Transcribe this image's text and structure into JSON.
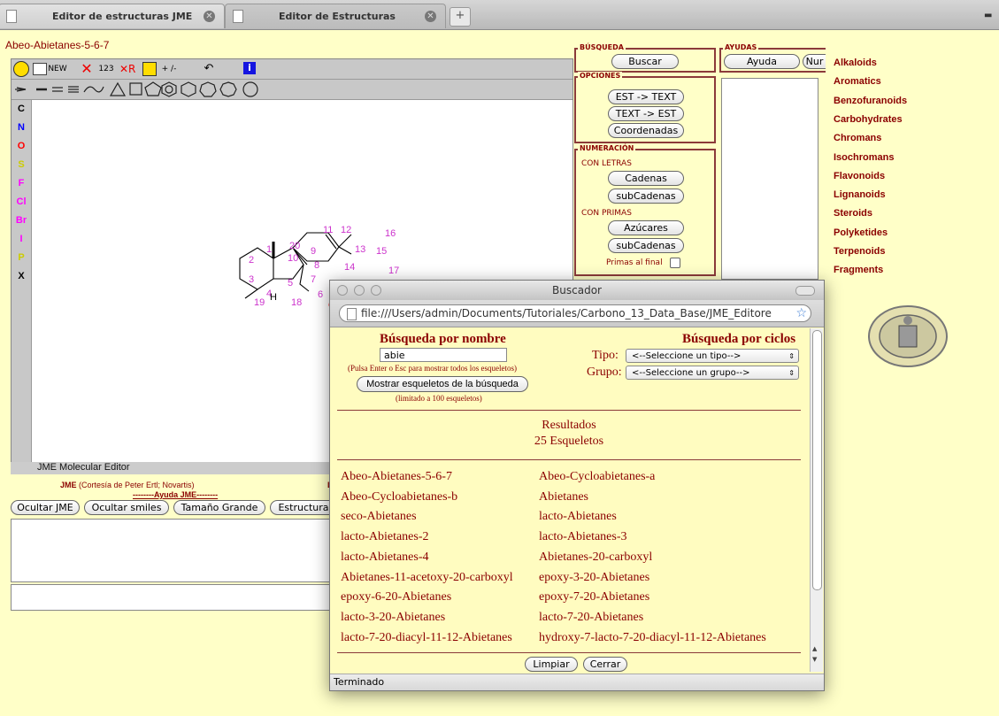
{
  "tabs": [
    {
      "title": "Editor de estructuras JME"
    },
    {
      "title": "Editor de Estructuras"
    }
  ],
  "new_tab_label": "+",
  "jme": {
    "molecule_title": "Abeo-Abietanes-5-6-7",
    "toolbar_row1": [
      "NEW",
      "123",
      "+ /-"
    ],
    "side_atoms": [
      "C",
      "N",
      "O",
      "S",
      "F",
      "Cl",
      "Br",
      "I",
      "P",
      "X"
    ],
    "atom_colors": {
      "C": "#000000",
      "N": "#0000ff",
      "O": "#ff0000",
      "S": "#cccc00",
      "F": "#ff00ff",
      "Cl": "#ff00ff",
      "Br": "#ff00ff",
      "I": "#ff00ff",
      "P": "#cccc00",
      "X": "#000000"
    },
    "status": "JME Molecular Editor",
    "credit_prefix": "JME",
    "credit_rest": " (Cortesía de Peter Ertl; Novartis)",
    "help_link": "--------Ayuda JME--------",
    "right_label": "L",
    "buttons": [
      "Ocultar JME",
      "Ocultar smiles",
      "Tamaño Grande",
      "Estructura"
    ],
    "atom_numbers": [
      "1",
      "2",
      "3",
      "4",
      "5",
      "6",
      "7",
      "8",
      "9",
      "10",
      "11",
      "12",
      "13",
      "14",
      "15",
      "16",
      "17",
      "18",
      "19",
      "20"
    ],
    "atom_h": "H",
    "atom_o": "O"
  },
  "busqueda": {
    "title": "BÚSQUEDA",
    "buscar": "Buscar"
  },
  "ayudas": {
    "title": "AYUDAS",
    "ayuda": "Ayuda",
    "num": "Nur"
  },
  "opciones": {
    "title": "OPCIONES",
    "buttons": [
      "EST -> TEXT",
      "TEXT -> EST",
      "Coordenadas"
    ]
  },
  "numeracion": {
    "title": "NUMERACIÓN",
    "con_letras": "CON LETRAS",
    "cadenas": "Cadenas",
    "subcadenas": "subCadenas",
    "con_primas": "CON PRIMAS",
    "azucares": "Azúcares",
    "subcadenas2": "subCadenas",
    "primas_final": "Primas al final"
  },
  "categories": [
    "Alkaloids",
    "Aromatics",
    "Benzofuranoids",
    "Carbohydrates",
    "Chromans",
    "Isochromans",
    "Flavonoids",
    "Lignanoids",
    "Steroids",
    "Polyketides",
    "Terpenoids",
    "Fragments"
  ],
  "buscador": {
    "window_title": "Buscador",
    "url": "file:///Users/admin/Documents/Tutoriales/Carbono_13_Data_Base/JME_Editore",
    "busqueda_nombre": "Búsqueda por nombre",
    "search_value": "abie",
    "hint": "(Pulsa Enter o Esc para mostrar todos los esqueletos)",
    "mostrar_button": "Mostrar esqueletos de la búsqueda",
    "limit": "(limitado a 100 esqueletos)",
    "busqueda_ciclos": "Búsqueda por ciclos",
    "tipo_label": "Tipo:",
    "tipo_value": "<--Seleccione un tipo-->",
    "grupo_label": "Grupo:",
    "grupo_value": "<--Seleccione un grupo-->",
    "resultados": "Resultados",
    "count": "25 Esqueletos",
    "results": [
      [
        "Abeo-Abietanes-5-6-7",
        "Abeo-Cycloabietanes-a"
      ],
      [
        "Abeo-Cycloabietanes-b",
        "Abietanes"
      ],
      [
        "seco-Abietanes",
        "lacto-Abietanes"
      ],
      [
        "lacto-Abietanes-2",
        "lacto-Abietanes-3"
      ],
      [
        "lacto-Abietanes-4",
        "Abietanes-20-carboxyl"
      ],
      [
        "Abietanes-11-acetoxy-20-carboxyl",
        "epoxy-3-20-Abietanes"
      ],
      [
        "epoxy-6-20-Abietanes",
        "epoxy-7-20-Abietanes"
      ],
      [
        "lacto-3-20-Abietanes",
        "lacto-7-20-Abietanes"
      ],
      [
        "lacto-7-20-diacyl-11-12-Abietanes",
        "hydroxy-7-lacto-7-20-diacyl-11-12-Abietanes"
      ]
    ],
    "limpiar": "Limpiar",
    "cerrar": "Cerrar",
    "status": "Terminado"
  }
}
